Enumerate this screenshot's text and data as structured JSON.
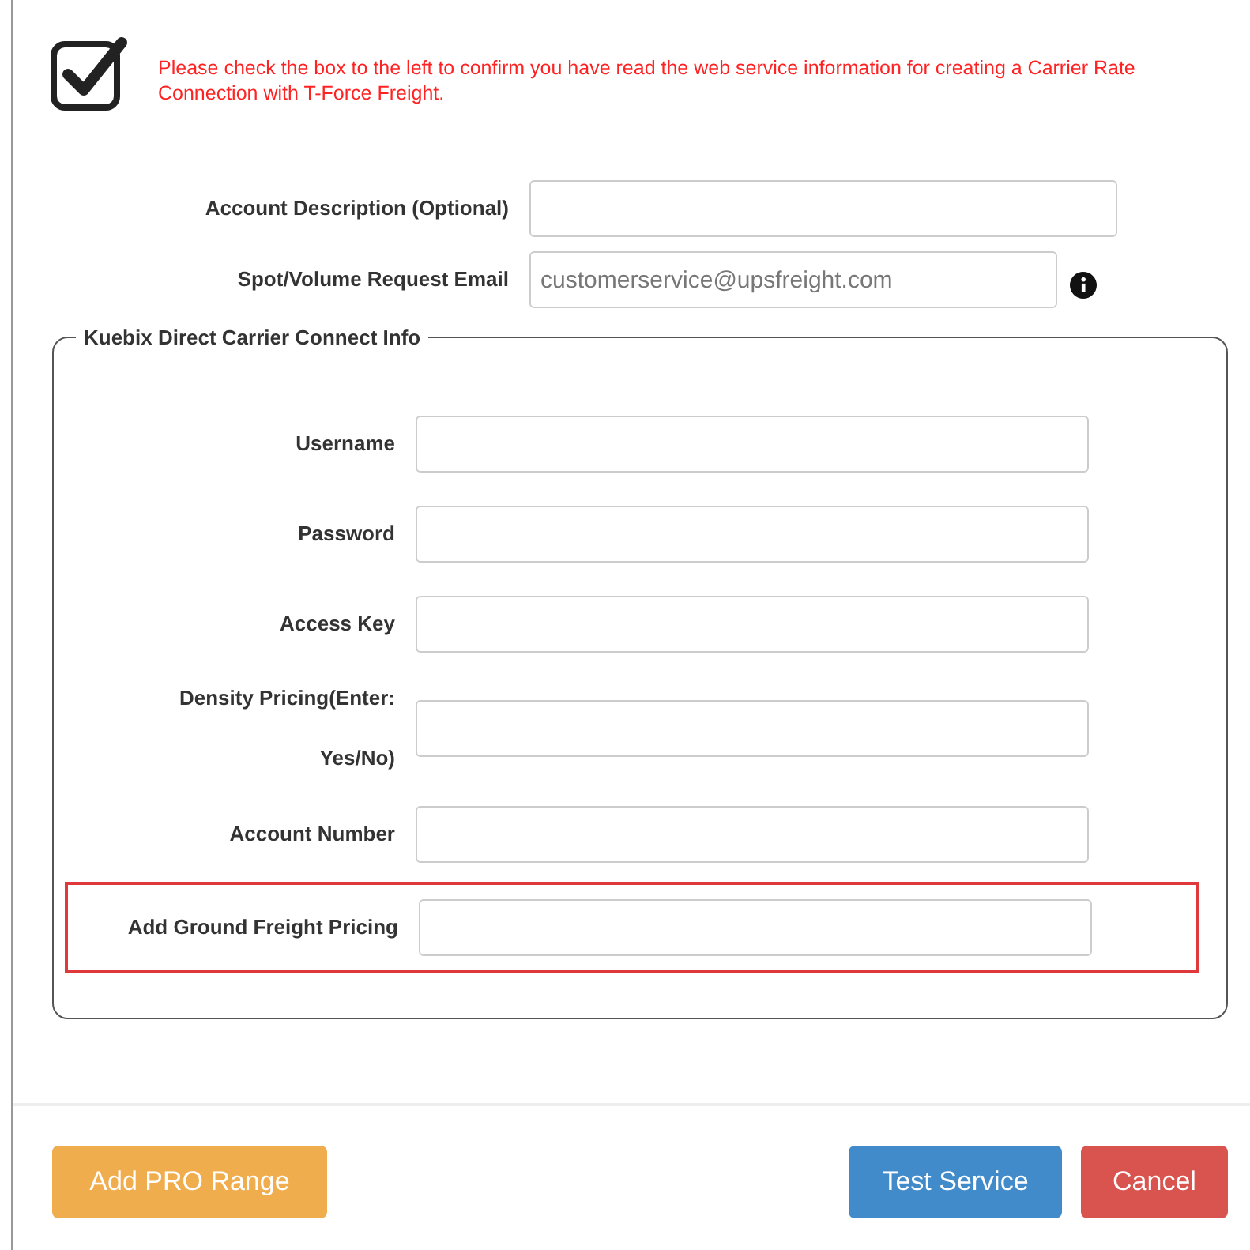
{
  "confirm": {
    "checked": true,
    "message": "Please check the box to the left to confirm you have read the web service information for creating a Carrier Rate Connection with T-Force Freight."
  },
  "top_fields": [
    {
      "label": "Account Description (Optional)",
      "info": false
    },
    {
      "label": "Spot/Volume Request Email",
      "value": "customerservice@upsfreight.com",
      "info": true
    }
  ],
  "section": {
    "legend": "Kuebix Direct Carrier Connect Info",
    "fields": [
      {
        "label": "Username",
        "highlighted": false
      },
      {
        "label": "Password",
        "highlighted": false
      },
      {
        "label": "Access Key",
        "highlighted": false
      },
      {
        "label": "Density Pricing(Enter: Yes/No)",
        "highlighted": false
      },
      {
        "label": "Account Number",
        "highlighted": false
      },
      {
        "label": "Add Ground Freight Pricing",
        "highlighted": true
      }
    ]
  },
  "buttons": [
    {
      "label": "Add PRO Range",
      "kind": "warning"
    },
    {
      "label": "Test Service",
      "kind": "primary"
    },
    {
      "label": "Cancel",
      "kind": "danger"
    }
  ]
}
